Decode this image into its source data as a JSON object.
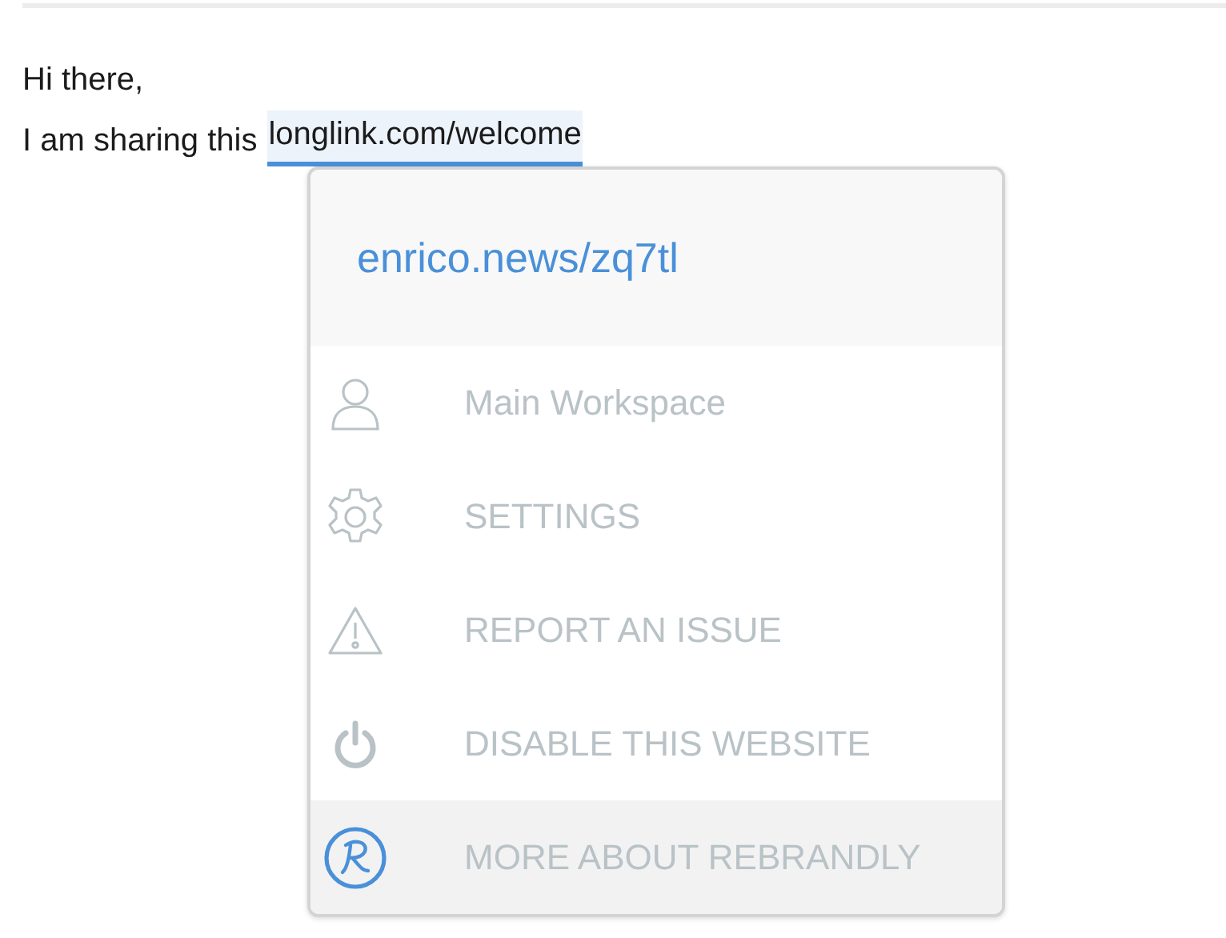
{
  "message": {
    "lines": [
      {
        "text": "Hi there,"
      },
      {
        "text": "I am sharing this",
        "link": "longlink.com/welcome"
      }
    ]
  },
  "popup": {
    "short_link": "enrico.news/zq7tl",
    "items": [
      {
        "kind": "person",
        "label": "Main Workspace",
        "selected": false
      },
      {
        "kind": "gear",
        "label": "SETTINGS",
        "selected": false
      },
      {
        "kind": "warning",
        "label": "REPORT AN ISSUE",
        "selected": false
      },
      {
        "kind": "power",
        "label": "DISABLE THIS WEBSITE",
        "selected": false
      },
      {
        "kind": "brand",
        "label": "MORE ABOUT REBRANDLY",
        "selected": true
      }
    ]
  }
}
